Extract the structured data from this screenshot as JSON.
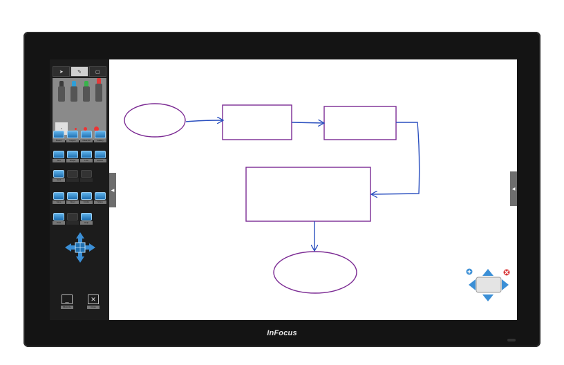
{
  "device": {
    "brand": "InFocus"
  },
  "sidebar": {
    "tabs": [
      {
        "icon": "pointer-icon",
        "label": ""
      },
      {
        "icon": "pen-icon",
        "label": ""
      },
      {
        "icon": "window-icon",
        "label": ""
      }
    ],
    "pen_colors": [
      "#3b3b3b",
      "#2f9fd8",
      "#38b34a",
      "#e23a3a"
    ],
    "dot_sizes": [
      "small",
      "medium",
      "large"
    ],
    "tool_rows": [
      [
        {
          "icon": "whiteboard-icon",
          "label": "Board"
        },
        {
          "icon": "draw-icon",
          "label": "Layers"
        },
        {
          "icon": "capture-icon",
          "label": "Clear All"
        },
        {
          "icon": "gallery-icon",
          "label": "Gallery"
        }
      ],
      [
        {
          "icon": "text-icon",
          "label": "Text"
        },
        {
          "icon": "shape-icon",
          "label": "Shape"
        },
        {
          "icon": "line-icon",
          "label": "Line"
        },
        {
          "icon": "eraser-icon",
          "label": "Eraser"
        }
      ],
      [
        {
          "icon": "grid-icon",
          "label": "Grid"
        },
        {
          "icon": "undo-icon",
          "label": ""
        },
        {
          "icon": "redo-icon",
          "label": ""
        }
      ],
      [
        {
          "icon": "save-icon",
          "label": "Save"
        },
        {
          "icon": "open-folder-icon",
          "label": "Open"
        },
        {
          "icon": "folder-icon",
          "label": "Folder"
        },
        {
          "icon": "export-icon",
          "label": "Share"
        }
      ],
      [
        {
          "icon": "print-icon",
          "label": "Print"
        },
        {
          "icon": "hand-icon",
          "label": ""
        },
        {
          "icon": "help-icon",
          "label": "Help"
        }
      ]
    ],
    "bottom_tools": [
      {
        "icon": "minimize-icon",
        "label": "Minimize"
      },
      {
        "icon": "close-icon",
        "label": "Close"
      }
    ]
  },
  "colors": {
    "shape_stroke": "#7b2a93",
    "arrow_stroke": "#2a4fbf",
    "nav_blue": "#3b8fd6",
    "close_red": "#d93636"
  }
}
